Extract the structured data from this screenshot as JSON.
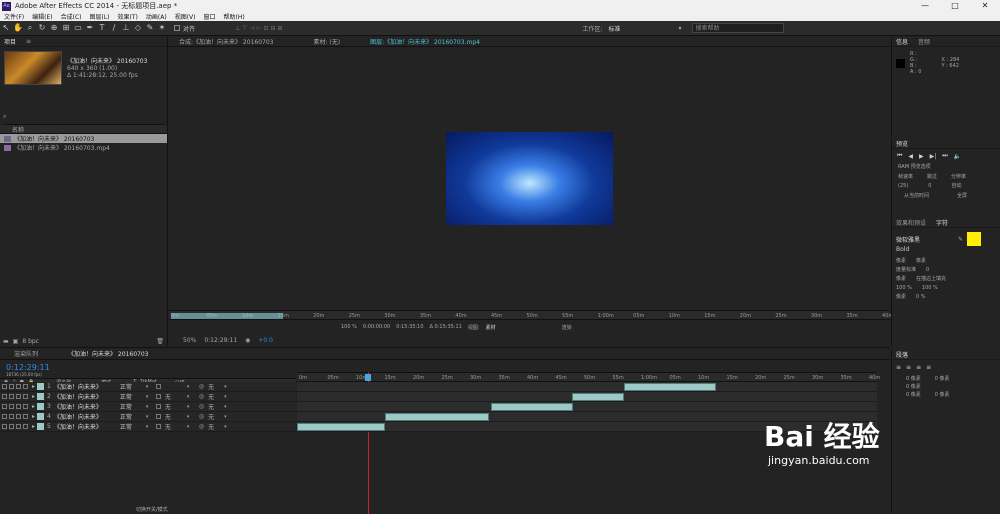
{
  "window": {
    "title": "Adobe After Effects CC 2014 - 无标题项目.aep *",
    "logo": "Ae"
  },
  "menu": [
    "文件(F)",
    "编辑(E)",
    "合成(C)",
    "图层(L)",
    "效果(T)",
    "动画(A)",
    "视图(V)",
    "窗口",
    "帮助(H)"
  ],
  "toolbar": {
    "snap_label": "对齐",
    "workspace_label": "工作区:",
    "workspace_value": "标准",
    "search_help": "搜索帮助"
  },
  "project": {
    "title": "项目",
    "selected_name": "《加油！向未来》 20160703",
    "selected_dims": "640 x 360 (1.00)",
    "selected_dur": "Δ 1:41:28:12, 25.00 fps",
    "col_name": "名称",
    "items": [
      {
        "name": "《加油！向未来》 20160703",
        "type": "comp"
      },
      {
        "name": "《加油！向未来》 20160703.mp4",
        "type": "footage"
      }
    ],
    "bpc": "8 bpc"
  },
  "viewer": {
    "tabs": [
      {
        "label": "合成:《加油！向未来》 20160703"
      },
      {
        "label": "素材: (无)"
      },
      {
        "label": "图层:《加油！向未来》 20160703.mp4"
      }
    ],
    "ruler": [
      "0m",
      "05m",
      "10m",
      "15m",
      "20m",
      "25m",
      "30m",
      "35m",
      "40m",
      "45m",
      "50m",
      "55m",
      "1:00m",
      "05m",
      "10m",
      "15m",
      "20m",
      "25m",
      "30m",
      "35m",
      "40m"
    ],
    "zoom": "100 %",
    "in": "0:00:00:00",
    "out": "0:15:35:10",
    "dur": "Δ 0:15:35:11",
    "view_label": "视图:",
    "view_value": "素材",
    "render_label": "渲染",
    "zoom2": "50%",
    "time": "0:12:29:11",
    "offset": "+0.0"
  },
  "info": {
    "tab1": "信息",
    "tab2": "音频",
    "r": "R :",
    "g": "G :",
    "b": "B :",
    "a": "A : 0",
    "x": "X : 284",
    "y": "Y : 642"
  },
  "preview": {
    "title": "预览",
    "ram": "RAM 预览选项",
    "framerate_label": "帧速率",
    "skip_label": "跳过",
    "res_label": "分辨率",
    "framerate": "(25)",
    "skip": "0",
    "res": "自动",
    "from_current": "从当前时间",
    "fullscreen": "全屏"
  },
  "char": {
    "tab1": "效果和预设",
    "tab2": "字符",
    "font": "微软雅黑",
    "style": "Bold",
    "size": "像素",
    "leading": "像素",
    "tracking": "度量标准",
    "kern": "0",
    "stroke": "像素",
    "stroke_mode": "在描边上填充",
    "vscale": "100 %",
    "hscale": "100 %",
    "baseline": "像素",
    "tsume": "0 %"
  },
  "para": {
    "title": "段落",
    "v1": "0 像素",
    "v2": "0 像素",
    "v3": "0 像素",
    "v4": "0 像素",
    "v5": "0 像素"
  },
  "timeline": {
    "tab_render": "渲染队列",
    "tab_comp": "《加油！向未来》 20160703",
    "timecode": "0:12:29:11",
    "frame": "18736 (25.00 fps)",
    "col_source": "源名称",
    "col_mode": "模式",
    "col_t": "T",
    "col_trkmat": "TrkMat",
    "col_parent": "父级",
    "ruler": [
      "0m",
      "05m",
      "10m",
      "15m",
      "20m",
      "25m",
      "30m",
      "35m",
      "40m",
      "45m",
      "50m",
      "55m",
      "1:00m",
      "05m",
      "10m",
      "15m",
      "20m",
      "25m",
      "30m",
      "35m",
      "40m"
    ],
    "layers": [
      {
        "num": "1",
        "name": "《加油！向未来》",
        "mode": "正常",
        "trkmat": "",
        "parent": "无"
      },
      {
        "num": "2",
        "name": "《加油！向未来》",
        "mode": "正常",
        "trkmat": "无",
        "parent": "无"
      },
      {
        "num": "3",
        "name": "《加油！向未来》",
        "mode": "正常",
        "trkmat": "无",
        "parent": "无"
      },
      {
        "num": "4",
        "name": "《加油！向未来》",
        "mode": "正常",
        "trkmat": "无",
        "parent": "无"
      },
      {
        "num": "5",
        "name": "《加油！向未来》",
        "mode": "正常",
        "trkmat": "无",
        "parent": "无"
      }
    ],
    "toggle_label": "切换开关/模式"
  },
  "watermark": {
    "text": "Bai 经验",
    "url": "jingyan.baidu.com"
  },
  "icons": [
    "search-icon",
    "play-icon",
    "eye-icon",
    "lock-icon",
    "gear-icon"
  ]
}
